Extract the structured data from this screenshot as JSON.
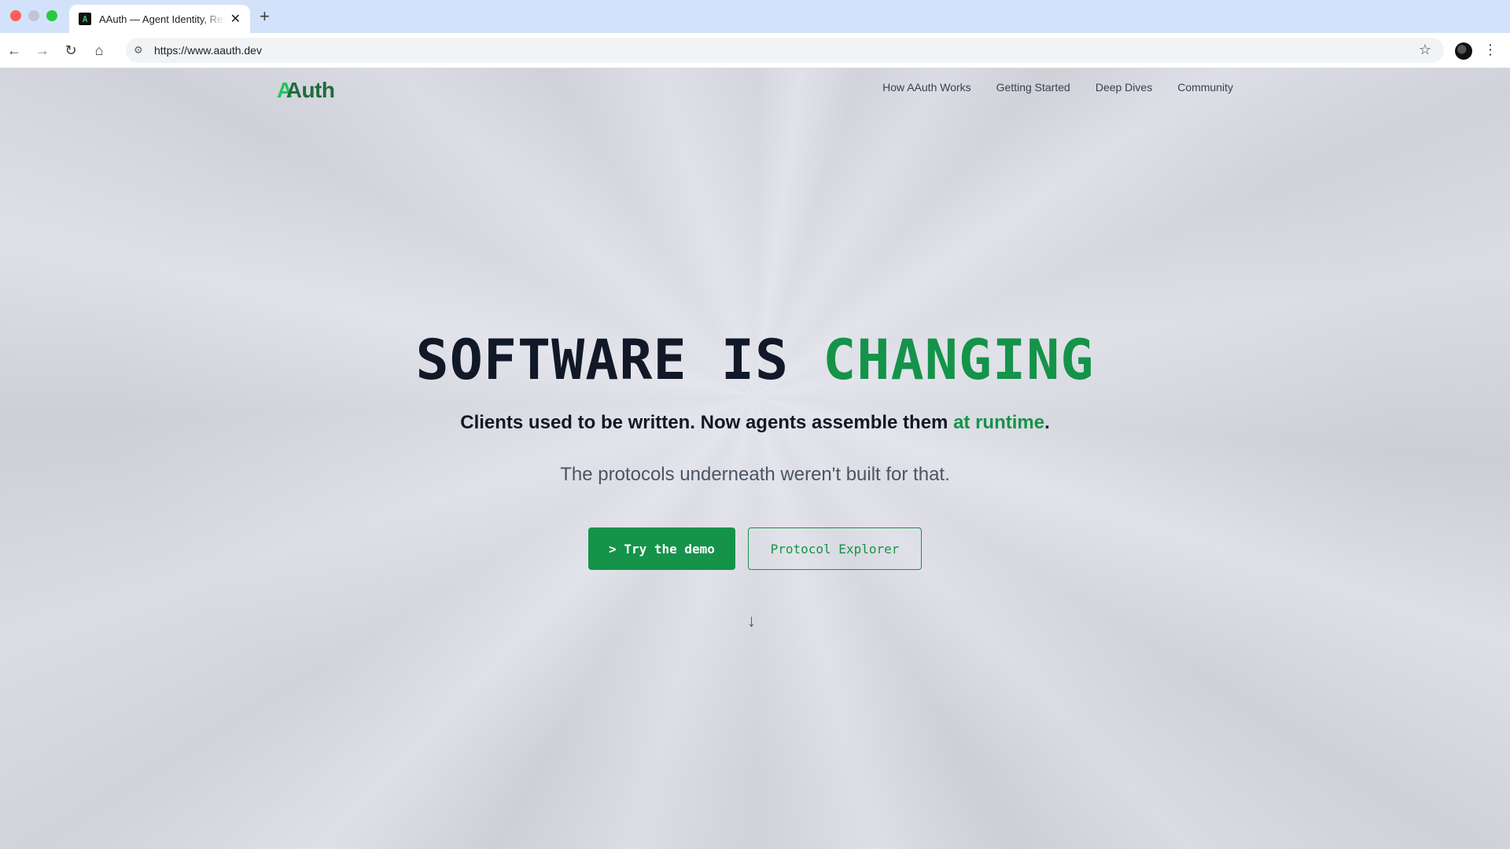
{
  "browser": {
    "tab_title": "AAuth — Agent Identity, Resource Access",
    "tab_favicon": "A",
    "new_tab": "+",
    "url": "https://www.aauth.dev",
    "icons": [
      "back-arrow-icon",
      "forward-arrow-icon",
      "reload-icon",
      "home-icon",
      "site-info-icon",
      "bookmark-star-icon",
      "profile-avatar",
      "kebab-menu-icon"
    ]
  },
  "header": {
    "logo_a": "A",
    "logo_rest": "Auth",
    "nav": [
      "How AAuth Works",
      "Getting Started",
      "Deep Dives",
      "Community"
    ]
  },
  "hero": {
    "headline_part1": "SOFTWARE IS ",
    "headline_accent": "CHANGING",
    "sub_part1": "Clients used to be written. Now agents assemble them ",
    "sub_accent": "at runtime",
    "sub_end": ".",
    "tagline": "The protocols underneath weren't built for that.",
    "primary_button": "> Try the demo",
    "secondary_button": "Protocol Explorer",
    "scroll_icon": "↓"
  },
  "colors": {
    "accent": "#15934a",
    "heading": "#111827",
    "logo_dark": "#1f6b3d",
    "logo_light": "#22c35e"
  }
}
